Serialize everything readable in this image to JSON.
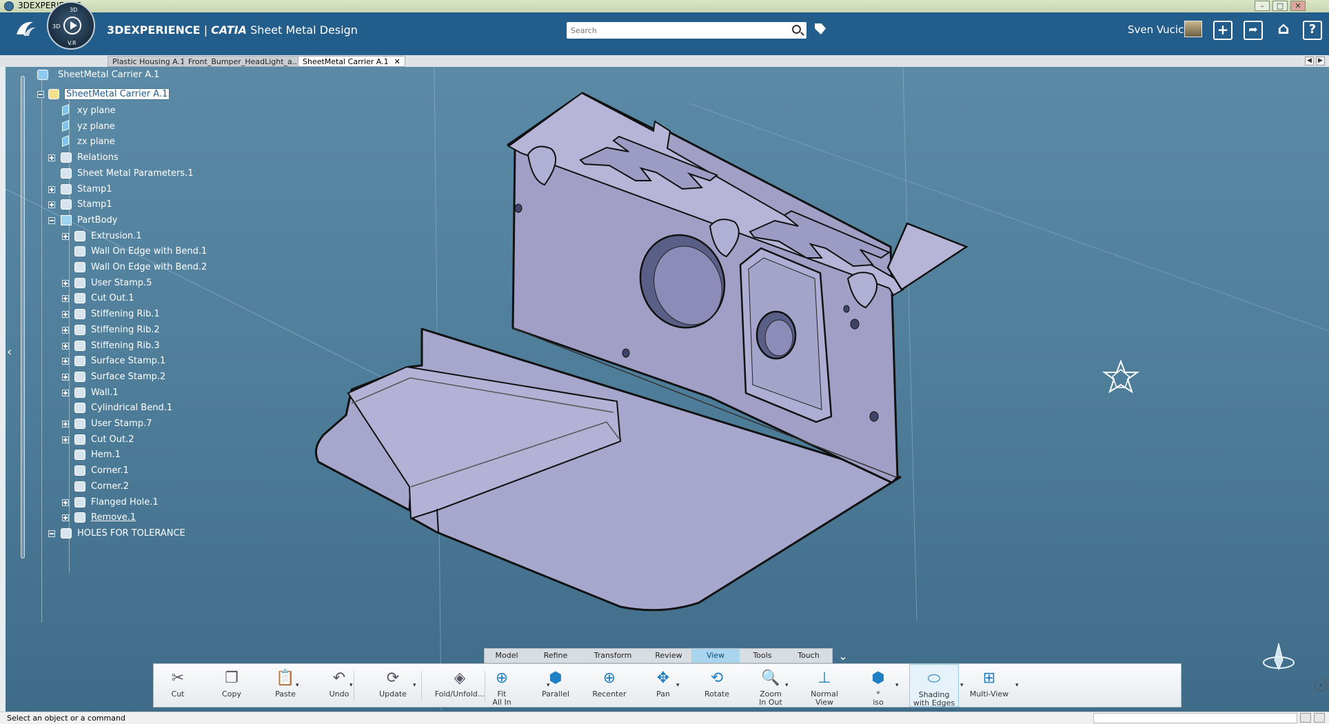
{
  "window": {
    "title": "3DEXPERIENCE",
    "controls": [
      "–",
      "□",
      "✕"
    ]
  },
  "header": {
    "app_title_brand": "3DEXPERIENCE",
    "app_title_sep": " | ",
    "app_title_catia": "CATIA",
    "app_title_app": " Sheet Metal Design",
    "compass_labels": {
      "top": "3D",
      "left": "3D",
      "bottom": "V.R"
    },
    "search": {
      "placeholder": "Search",
      "value": ""
    },
    "user_name": "Sven Vucic"
  },
  "tabs": [
    {
      "label": "Plastic Housing A.1",
      "active": false
    },
    {
      "label": "Front_Bumper_HeadLight_a...",
      "active": false
    },
    {
      "label": "SheetMetal Carrier A.1",
      "active": true,
      "close": "✕"
    }
  ],
  "tree": {
    "root": "SheetMetal Carrier A.1",
    "part": "SheetMetal Carrier A.1",
    "items": [
      {
        "label": "xy plane",
        "level": 2,
        "expand": "none",
        "icon": "plane-icon"
      },
      {
        "label": "yz plane",
        "level": 2,
        "expand": "none",
        "icon": "plane-icon"
      },
      {
        "label": "zx plane",
        "level": 2,
        "expand": "none",
        "icon": "plane-icon"
      },
      {
        "label": "Relations",
        "level": 2,
        "expand": "plus",
        "icon": "relations-icon"
      },
      {
        "label": "Sheet Metal Parameters.1",
        "level": 2,
        "expand": "none",
        "icon": "parameters-icon"
      },
      {
        "label": "Stamp1",
        "level": 2,
        "expand": "plus",
        "icon": "stamp-icon"
      },
      {
        "label": "Stamp1",
        "level": 2,
        "expand": "plus",
        "icon": "stamp-icon"
      },
      {
        "label": "PartBody",
        "level": 2,
        "expand": "minus",
        "icon": "partbody-icon"
      },
      {
        "label": "Extrusion.1",
        "level": 3,
        "expand": "plus",
        "icon": "extrusion-icon"
      },
      {
        "label": "Wall On Edge with Bend.1",
        "level": 3,
        "expand": "none",
        "icon": "wall-edge-icon"
      },
      {
        "label": "Wall On Edge with Bend.2",
        "level": 3,
        "expand": "none",
        "icon": "wall-edge-icon"
      },
      {
        "label": "User Stamp.5",
        "level": 3,
        "expand": "plus",
        "icon": "user-stamp-icon"
      },
      {
        "label": "Cut Out.1",
        "level": 3,
        "expand": "plus",
        "icon": "cutout-icon"
      },
      {
        "label": "Stiffening Rib.1",
        "level": 3,
        "expand": "plus",
        "icon": "stiffening-rib-icon"
      },
      {
        "label": "Stiffening Rib.2",
        "level": 3,
        "expand": "plus",
        "icon": "stiffening-rib-icon"
      },
      {
        "label": "Stiffening Rib.3",
        "level": 3,
        "expand": "plus",
        "icon": "stiffening-rib-icon"
      },
      {
        "label": "Surface Stamp.1",
        "level": 3,
        "expand": "plus",
        "icon": "surface-stamp-icon"
      },
      {
        "label": "Surface Stamp.2",
        "level": 3,
        "expand": "plus",
        "icon": "surface-stamp-icon"
      },
      {
        "label": "Wall.1",
        "level": 3,
        "expand": "plus",
        "icon": "wall-icon"
      },
      {
        "label": "Cylindrical Bend.1",
        "level": 3,
        "expand": "none",
        "icon": "cylindrical-bend-icon"
      },
      {
        "label": "User Stamp.7",
        "level": 3,
        "expand": "plus",
        "icon": "user-stamp-icon"
      },
      {
        "label": "Cut Out.2",
        "level": 3,
        "expand": "plus",
        "icon": "cutout-icon"
      },
      {
        "label": "Hem.1",
        "level": 3,
        "expand": "none",
        "icon": "hem-icon"
      },
      {
        "label": "Corner.1",
        "level": 3,
        "expand": "none",
        "icon": "corner-icon"
      },
      {
        "label": "Corner.2",
        "level": 3,
        "expand": "none",
        "icon": "corner-icon"
      },
      {
        "label": "Flanged Hole.1",
        "level": 3,
        "expand": "plus",
        "icon": "flanged-hole-icon"
      },
      {
        "label": "Remove.1",
        "level": 3,
        "expand": "plus",
        "icon": "remove-icon"
      },
      {
        "label": "HOLES FOR TOLERANCE",
        "level": 2,
        "expand": "minus",
        "icon": "geometrical-set-icon"
      }
    ]
  },
  "section_tabs": [
    {
      "label": "Model",
      "active": false
    },
    {
      "label": "Refine",
      "active": false
    },
    {
      "label": "Transform",
      "active": false
    },
    {
      "label": "Review",
      "active": false
    },
    {
      "label": "View",
      "active": true
    },
    {
      "label": "Tools",
      "active": false
    },
    {
      "label": "Touch",
      "active": false
    }
  ],
  "actions": [
    {
      "label": "Cut",
      "icon": "scissors-icon",
      "glyph": "✂"
    },
    {
      "label": "Copy",
      "icon": "copy-icon",
      "glyph": "❐"
    },
    {
      "label": "Paste",
      "icon": "paste-icon",
      "glyph": "📋"
    },
    {
      "label": "Undo",
      "icon": "undo-icon",
      "glyph": "↶"
    },
    {
      "label": "Update",
      "icon": "update-icon",
      "glyph": "⟳"
    },
    {
      "label": "Fold/Unfold...",
      "icon": "fold-unfold-icon",
      "glyph": "◈"
    },
    {
      "label": "Fit\nAll In",
      "icon": "fit-all-icon",
      "glyph": "⊕"
    },
    {
      "label": "Parallel",
      "icon": "parallel-icon",
      "glyph": "⬢"
    },
    {
      "label": "Recenter",
      "icon": "recenter-icon",
      "glyph": "⊕"
    },
    {
      "label": "Pan",
      "icon": "pan-icon",
      "glyph": "✥"
    },
    {
      "label": "Rotate",
      "icon": "rotate-icon",
      "glyph": "⟲"
    },
    {
      "label": "Zoom\nIn Out",
      "icon": "zoom-icon",
      "glyph": "🔍"
    },
    {
      "label": "Normal\nView",
      "icon": "normal-view-icon",
      "glyph": "⊥"
    },
    {
      "label": "*\niso",
      "icon": "iso-view-icon",
      "glyph": "⬢"
    },
    {
      "label": "Shading\nwith Edges",
      "icon": "shading-edges-icon",
      "glyph": "⬭"
    },
    {
      "label": "Multi-View",
      "icon": "multi-view-icon",
      "glyph": "⊞"
    }
  ],
  "status": {
    "message": "Select an object or a command"
  },
  "colors": {
    "header": "#235d8b",
    "viewport": "#4d7b97",
    "part_fill": "#a8a6cc",
    "active_tab": "#a9d4ee"
  }
}
